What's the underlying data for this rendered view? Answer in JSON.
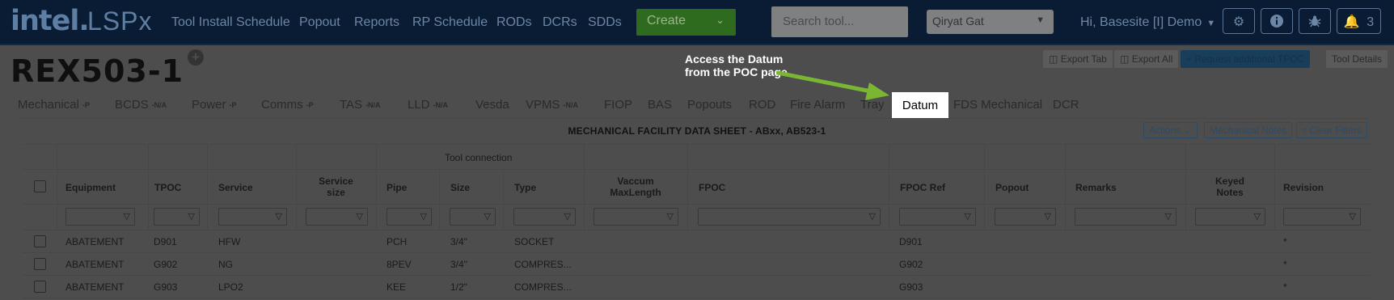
{
  "navbar": {
    "logo": "intel.",
    "product": "LSPx",
    "links": [
      "Tool Install Schedule",
      "Popout",
      "Reports",
      "RP Schedule",
      "RODs",
      "DCRs",
      "SDDs"
    ],
    "create_label": "Create",
    "search_placeholder": "Search tool...",
    "site": "Qiryat Gat",
    "greeting": "Hi, Basesite [I] Demo",
    "notification_count": "3"
  },
  "page": {
    "title": "REX503-1",
    "buttons": {
      "export_tab": "Export Tab",
      "export_all": "Export All",
      "request_tpoc": "+ Request additional TPOC",
      "tool_details": "Tool Details"
    }
  },
  "tabs": [
    {
      "label": "Mechanical",
      "tag": "-P"
    },
    {
      "label": "BCDS",
      "tag": "-N/A"
    },
    {
      "label": "Power",
      "tag": "-P"
    },
    {
      "label": "Comms",
      "tag": "-P"
    },
    {
      "label": "TAS",
      "tag": "-N/A"
    },
    {
      "label": "LLD",
      "tag": "-N/A"
    },
    {
      "label": "Vesda",
      "tag": ""
    },
    {
      "label": "VPMS",
      "tag": "-N/A"
    },
    {
      "label": "FIOP",
      "tag": ""
    },
    {
      "label": "BAS",
      "tag": ""
    },
    {
      "label": "Popouts",
      "tag": ""
    },
    {
      "label": "ROD",
      "tag": ""
    },
    {
      "label": "Fire Alarm",
      "tag": ""
    },
    {
      "label": "Tray",
      "tag": ""
    },
    {
      "label": "Datum",
      "tag": ""
    },
    {
      "label": "FDS Mechanical",
      "tag": ""
    },
    {
      "label": "DCR",
      "tag": ""
    }
  ],
  "callout": {
    "line1": "Access the Datum",
    "line2": "from the POC page.",
    "color": "#7ab534"
  },
  "sheet": {
    "title": "MECHANICAL FACILITY DATA SHEET - ABxx, AB523-1",
    "actions_label": "Actions",
    "mech_notes_label": "Mechanical Notes",
    "clear_filters_label": "Clear Filters",
    "group_label": "Tool connection",
    "columns": {
      "equipment": "Equipment",
      "tpoc": "TPOC",
      "service": "Service",
      "service_size_1": "Service",
      "service_size_2": "size",
      "pipe": "Pipe",
      "size": "Size",
      "type": "Type",
      "vaccum_1": "Vaccum",
      "vaccum_2": "MaxLength",
      "fpoc": "FPOC",
      "fpoc_ref": "FPOC Ref",
      "popout": "Popout",
      "remarks": "Remarks",
      "keyed_1": "Keyed",
      "keyed_2": "Notes",
      "revision": "Revision"
    },
    "rows": [
      {
        "equipment": "ABATEMENT",
        "tpoc": "D901",
        "service": "HFW",
        "pipe": "PCH",
        "size": "3/4\"",
        "type": "SOCKET",
        "fpoc_ref": "D901",
        "revision": "*"
      },
      {
        "equipment": "ABATEMENT",
        "tpoc": "G902",
        "service": "NG",
        "pipe": "8PEV",
        "size": "3/4\"",
        "type": "COMPRES...",
        "fpoc_ref": "G902",
        "revision": "*"
      },
      {
        "equipment": "ABATEMENT",
        "tpoc": "G903",
        "service": "LPO2",
        "pipe": "KEE",
        "size": "1/2\"",
        "type": "COMPRES...",
        "fpoc_ref": "G903",
        "revision": "*"
      }
    ]
  }
}
